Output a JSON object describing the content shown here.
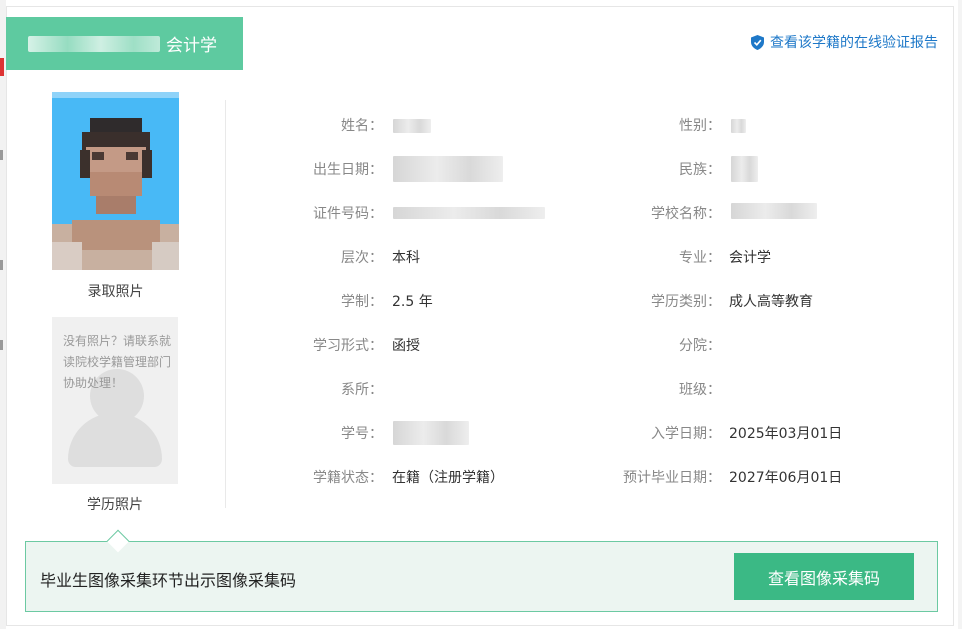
{
  "record": {
    "major_title": "会计学"
  },
  "verify_link": {
    "label": "查看该学籍的在线验证报告",
    "icon": "shield-check-icon",
    "color": "#1e78c8"
  },
  "photos": {
    "admission_caption": "录取照片",
    "education_caption": "学历照片",
    "no_photo_message": "没有照片？请联系就读院校学籍管理部门协助处理！"
  },
  "fields": {
    "name": {
      "label": "姓名：",
      "value": ""
    },
    "gender": {
      "label": "性别：",
      "value": ""
    },
    "birth_date": {
      "label": "出生日期：",
      "value": ""
    },
    "ethnicity": {
      "label": "民族：",
      "value": ""
    },
    "id_number": {
      "label": "证件号码：",
      "value": ""
    },
    "school_name": {
      "label": "学校名称：",
      "value": ""
    },
    "level": {
      "label": "层次：",
      "value": "本科"
    },
    "major": {
      "label": "专业：",
      "value": "会计学"
    },
    "duration": {
      "label": "学制：",
      "value": "2.5 年"
    },
    "education_type": {
      "label": "学历类别：",
      "value": "成人高等教育"
    },
    "study_form": {
      "label": "学习形式：",
      "value": "函授"
    },
    "branch": {
      "label": "分院：",
      "value": ""
    },
    "department": {
      "label": "系所：",
      "value": ""
    },
    "class": {
      "label": "班级：",
      "value": ""
    },
    "student_id": {
      "label": "学号：",
      "value": ""
    },
    "enrollment_date": {
      "label": "入学日期：",
      "value": "2025年03月01日"
    },
    "status": {
      "label": "学籍状态：",
      "value": "在籍（注册学籍）"
    },
    "expected_graduation": {
      "label": "预计毕业日期：",
      "value": "2027年06月01日"
    }
  },
  "notice": {
    "text": "毕业生图像采集环节出示图像采集码",
    "button_label": "查看图像采集码"
  },
  "colors": {
    "accent_green": "#5ecaa0",
    "button_green": "#3bb985",
    "notice_bg": "#ecf5f1",
    "photo_bg": "#48b9f6"
  }
}
